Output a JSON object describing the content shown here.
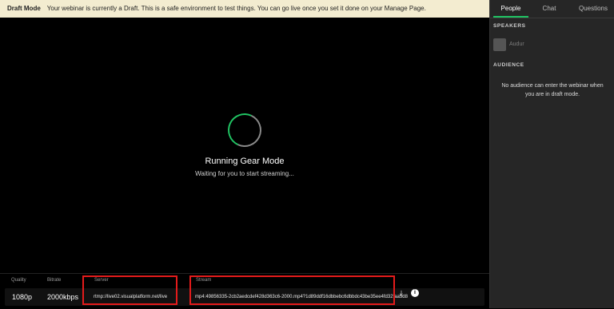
{
  "banner": {
    "label": "Draft Mode",
    "message": "Your webinar is currently a Draft. This is a safe environment to test things. You can go live once you set it done on your Manage Page."
  },
  "stage": {
    "title": "Running Gear Mode",
    "subtitle": "Waiting for you to start streaming..."
  },
  "stream_info": {
    "quality_label": "Quality",
    "bitrate_label": "Bitrate",
    "server_label": "Server",
    "stream_label": "Stream",
    "quality": "1080p",
    "bitrate": "2000kbps",
    "server": "rtmp://live02.visualplatform.net/live",
    "stream": "mp4:49856335-2cb2aedcdef428d363c6-2000.mp4?1d89ddf16dbbebc6dbbdc43be35ee4fd32faa5d8"
  },
  "icons": {
    "download": "download-icon",
    "info": "info-icon"
  },
  "sidebar": {
    "tabs": [
      {
        "label": "People",
        "active": true
      },
      {
        "label": "Chat",
        "active": false
      },
      {
        "label": "Questions",
        "active": false
      }
    ],
    "speakers_heading": "SPEAKERS",
    "speakers": [
      {
        "name": "Audur"
      }
    ],
    "audience_heading": "AUDIENCE",
    "audience_message": "No audience can enter the webinar when you are in draft mode."
  },
  "colors": {
    "accent": "#20c463",
    "highlight_box": "#e31b1b",
    "banner_bg": "#f3ecd0"
  }
}
